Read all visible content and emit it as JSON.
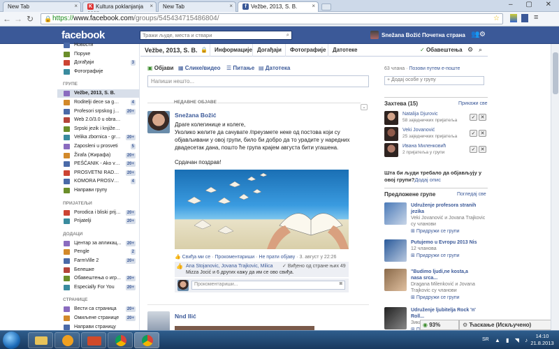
{
  "browser": {
    "tabs": [
      {
        "label": "New Tab"
      },
      {
        "label": "Kultura poklanjanja ocen"
      },
      {
        "label": "New Tab"
      },
      {
        "label": "Vežbe, 2013, S. B."
      }
    ],
    "url_protocol": "https://",
    "url_domain": "www.facebook.com",
    "url_path": "/groups/545434715486804/"
  },
  "fb": {
    "logo": "facebook",
    "search_placeholder": "Тражи људе, места и ствари",
    "user": "Snežana Božić",
    "home": "Почетна страна"
  },
  "left": {
    "top_items": [
      {
        "label": "Новости",
        "count": ""
      },
      {
        "label": "Поруке",
        "count": ""
      },
      {
        "label": "Догађаји",
        "count": "3"
      },
      {
        "label": "Фотографије",
        "count": ""
      }
    ],
    "groups_title": "ГРУПЕ",
    "groups": [
      {
        "label": "Vežbe, 2013, S. B.",
        "count": ""
      },
      {
        "label": "Roditelji dece sa gov...",
        "count": "4"
      },
      {
        "label": "Profesori srpskog jez...",
        "count": "20+"
      },
      {
        "label": "Web 2.0/3.0 u obrazovanju",
        "count": ""
      },
      {
        "label": "Srpski jezik i književnost",
        "count": ""
      },
      {
        "label": "Velika zbornica - gru...",
        "count": "20+"
      },
      {
        "label": "Zaposleni u prosveti",
        "count": "5"
      },
      {
        "label": "Žirafa (Жирафа)",
        "count": "20+"
      },
      {
        "label": "PEŠČANIK - Ako vam...",
        "count": "20+"
      },
      {
        "label": "PROSVETNI RADNIC...",
        "count": "20+"
      },
      {
        "label": "KOMORA PROSVETN...",
        "count": "4"
      },
      {
        "label": "Направи групу",
        "count": ""
      }
    ],
    "friends_title": "ПРИЈАТЕЉИ",
    "friends": [
      {
        "label": "Porodica i bliski prijat...",
        "count": "20+"
      },
      {
        "label": "Prijatelji",
        "count": "20+"
      }
    ],
    "apps_title": "ДОДАЦИ",
    "apps": [
      {
        "label": "Центар за апликац...",
        "count": "20+"
      },
      {
        "label": "Pengle",
        "count": "2"
      },
      {
        "label": "FarmVille 2",
        "count": "20+"
      },
      {
        "label": "Белешке",
        "count": ""
      },
      {
        "label": "Обавештења о игр...",
        "count": "20+"
      },
      {
        "label": "Especially For You",
        "count": "20+"
      }
    ],
    "pages_title": "СТРАНИЦЕ",
    "pages": [
      {
        "label": "Вести са страница",
        "count": "20+"
      },
      {
        "label": "Омиљене странице",
        "count": "20+"
      },
      {
        "label": "Направи страницу",
        "count": ""
      }
    ]
  },
  "group": {
    "name": "Vežbe, 2013, S. B.",
    "tabs": [
      "Информације",
      "Догађаји",
      "Фотографије",
      "Датотеке"
    ],
    "notifications": "Обавештења"
  },
  "composer": {
    "actions": [
      "Објави",
      "Слике/видео",
      "Питање",
      "Датотека"
    ],
    "placeholder": "Напиши нешто..."
  },
  "feed": {
    "recent_label": "НЕДАВНЕ ОБЈАВЕ",
    "post": {
      "author": "Snežana Božić",
      "lines": [
        "Драге колегинице и колеге,",
        "Уколико желите да сачувате /преузмете неке од постова који су",
        "објављивани у овој групи, било би добро да то урадите у наредних",
        "двадесетак дана, пошто ће група крајем августа бити угашена."
      ],
      "greeting": "Срдачан поздрав!",
      "actions": {
        "like": "Свиђа ми се",
        "comment": "Прокоментариши",
        "unfollow": "Не прати објаву",
        "time": "3. август у 22:26"
      },
      "likes_text_1": "Ana Stojanovic, Jovana Trajkovic, Milica",
      "likes_text_2": "Mizza Jocić и 6 других кажу да им се ово свиђа.",
      "seen": "Виђено од стране њих 49",
      "comment_placeholder": "Прокоментариши..."
    },
    "second_author": "Nnd Ilić"
  },
  "right": {
    "members": "63 члана",
    "invite": "Позови путем е-поште",
    "add_placeholder": "+ Додај особе у групу",
    "requests_title": "Захтева (15)",
    "show_all": "Прикажи све",
    "requests": [
      {
        "name": "Natalija Djurovic",
        "mutual": "58 заједничких пријатеља"
      },
      {
        "name": "Veki Jovanović",
        "mutual": "25 заједничких пријатеља"
      },
      {
        "name": "Ивана Миленковић",
        "mutual": "2 пријатеља у групи"
      }
    ],
    "question_1": "Шта би људи требало да објављују у",
    "question_2": "овој групи?",
    "add_description": "Додај опис",
    "suggested_title": "Предложене групе",
    "see_all": "Погледај све",
    "suggested": [
      {
        "name_1": "Udruženje profesora stranih",
        "name_2": "jezika",
        "info": "Veki Jovanović и Jovana Trajkovic",
        "info2": "су чланови",
        "join": "Придружи се групи"
      },
      {
        "name_1": "Putujemo u Evropu 2013 Nis",
        "name_2": "",
        "info": "12 чланова",
        "info2": "",
        "join": "Придружи се групи"
      },
      {
        "name_1": "\"Budimo ljudi,ne kosta,a",
        "name_2": "nasa srca...",
        "info": "Dragana Milenković и Jovana",
        "info2": "Trajkovic су чланови",
        "join": "Придружи се групи"
      },
      {
        "name_1": "Udruženje ljubitelja Rock 'n'",
        "name_2": "Roll...",
        "info": "Зика Ди",
        "info2": "",
        "join": "Придружи се групи"
      }
    ]
  },
  "chat": {
    "battery": "93%",
    "label": "Ћаскање (Искључено)"
  },
  "taskbar": {
    "lang": "SR",
    "time": "14:10",
    "date": "21.8.2013"
  },
  "colors": {
    "fb_blue": "#3b5998",
    "link": "#3b5998",
    "taskbar": "#1f4a75"
  }
}
